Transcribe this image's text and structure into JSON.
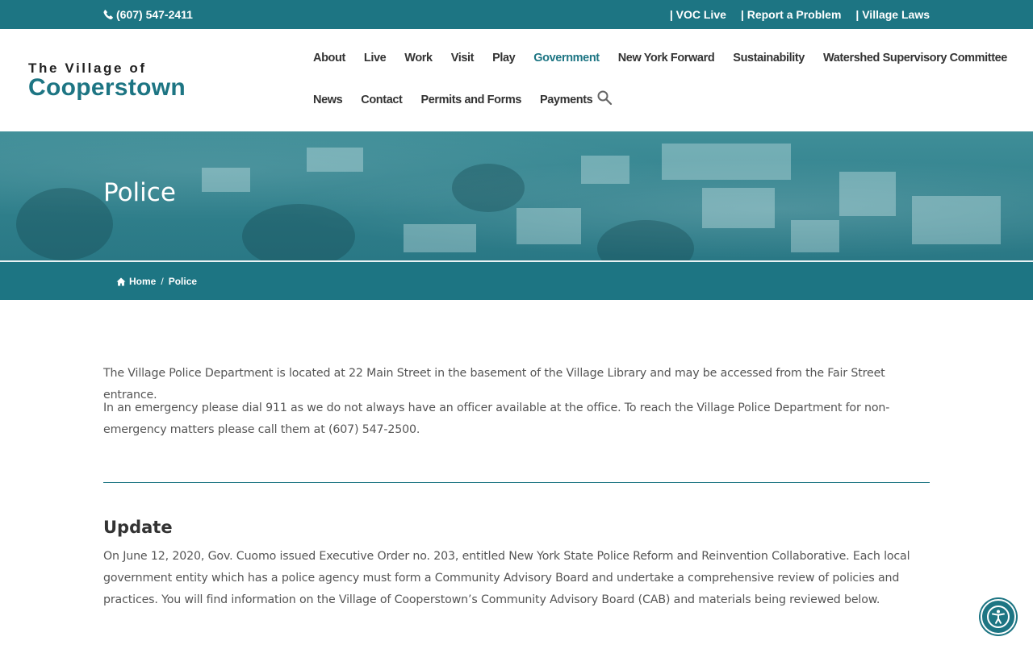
{
  "topbar": {
    "phone": "(607) 547-2411",
    "links": [
      "| VOC Live",
      "| Report a Problem",
      "| Village Laws"
    ]
  },
  "logo": {
    "line1": "The Village of",
    "line2": "Cooperstown"
  },
  "nav": {
    "row1": [
      "About",
      "Live",
      "Work",
      "Visit",
      "Play",
      "Government",
      "New York Forward",
      "Sustainability",
      "Watershed Supervisory Committee"
    ],
    "row2": [
      "News",
      "Contact",
      "Permits and Forms",
      "Payments"
    ],
    "active": "Government"
  },
  "hero": {
    "title": "Police"
  },
  "breadcrumb": {
    "home": "Home",
    "separator": "/",
    "current": "Police"
  },
  "content": {
    "p1": "The Village Police Department is located at 22 Main Street in the basement of the Village Library and may be accessed from the Fair Street entrance.",
    "p2": "In an emergency please dial 911 as we do not always have an officer available at the office.  To reach the Village Police Department for non-emergency matters please call them at (607) 547-2500.",
    "update_title": "Update",
    "p3": "On June 12, 2020, Gov. Cuomo issued Executive Order no. 203, entitled New York State Police Reform and Reinvention Collaborative. Each local government entity which has a police agency must form a Community Advisory Board and undertake a comprehensive review of policies and practices. You will find information on the Village of Cooperstown’s Community Advisory Board (CAB) and materials being reviewed below."
  },
  "colors": {
    "brand": "#1d7583",
    "text": "#555555",
    "heading": "#333333"
  },
  "icons": [
    "phone-icon",
    "search-icon",
    "home-icon",
    "accessibility-icon"
  ]
}
